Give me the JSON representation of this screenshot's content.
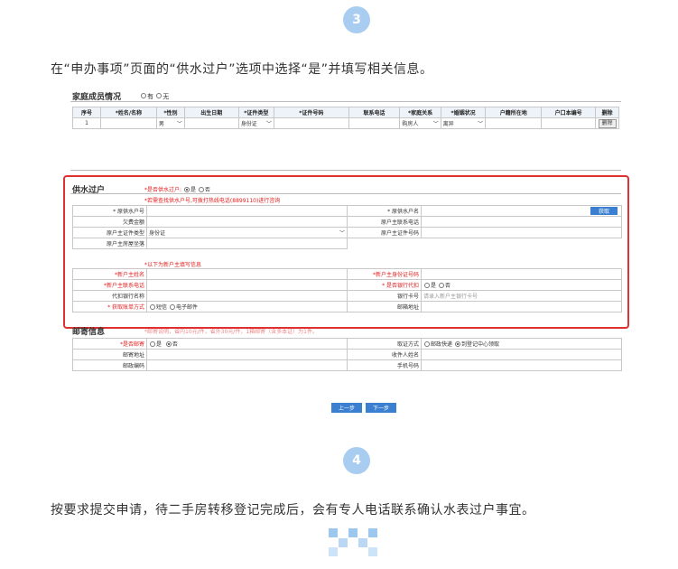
{
  "steps": [
    {
      "number": "3",
      "text": "在“申办事项”页面的“供水过户”选项中选择“是”并填写相关信息。"
    },
    {
      "number": "4",
      "text": "按要求提交申请，待二手房转移登记完成后，会有专人电话联系确认水表过户事宜。"
    }
  ],
  "family": {
    "title": "家庭成员情况",
    "radio_yes": "有",
    "radio_no": "无",
    "columns": [
      "序号",
      "*姓名/名称",
      "*性别",
      "出生日期",
      "*证件类型",
      "*证件号码",
      "联系电话",
      "*家庭关系",
      "*婚姻状况",
      "户籍所在地",
      "户口本编号",
      "删除"
    ],
    "row": {
      "index": "1",
      "gender": "男",
      "id_type": "身份证",
      "relation": "购房人",
      "marital": "离异",
      "delete": "删除"
    }
  },
  "water": {
    "title": "供水过户",
    "question": "*是否供水过户:",
    "yes": "是",
    "no": "否",
    "note1": "*若需查找供水户号,可拨打热线电话(8899110)进行咨询",
    "note2": "*以下为新户主填写信息",
    "rows": [
      {
        "l1": "* 原供水户号",
        "l2": "* 原供水户名",
        "button": "获取"
      },
      {
        "l1": "欠费金额",
        "l2": "原户主联系电话"
      },
      {
        "l1": "原户主证件类型",
        "v1": "身份证",
        "l2": "原户主证件号码"
      },
      {
        "l1": "原户主房屋坐落"
      }
    ],
    "rows2": [
      {
        "l1": "*新户主姓名",
        "l2": "*新户主身份证号码"
      },
      {
        "l1": "*新户主联系电话",
        "l2": "* 是否银行代扣",
        "yes": "是",
        "no": "否"
      },
      {
        "l1": "代扣银行名称",
        "l2": "银行卡号",
        "placeholder": "请录入新户主银行卡号"
      },
      {
        "l1": "* 获取账单方式",
        "opt1": "短信",
        "opt2": "电子邮件",
        "l2": "邮箱地址"
      }
    ]
  },
  "mail": {
    "title": "邮寄信息",
    "overlap_note": "*邮寄说明，省内10元/件，省外30元/件，1箱邮寄（含多本证）为1件。",
    "rows": [
      {
        "l1": "*是否邮寄",
        "yes": "是",
        "no": "否",
        "l2": "取证方式",
        "opt1": "邮政快递",
        "opt2": "到登记中心领取"
      },
      {
        "l1": "邮寄地址",
        "l2": "收件人姓名"
      },
      {
        "l1": "邮政编码",
        "l2": "手机号码"
      }
    ]
  },
  "nav": {
    "prev": "上一步",
    "next": "下一步"
  },
  "colors": {
    "accent": "#3a7fd0",
    "highlight": "#e03030",
    "circle": "#a9cdf0"
  }
}
